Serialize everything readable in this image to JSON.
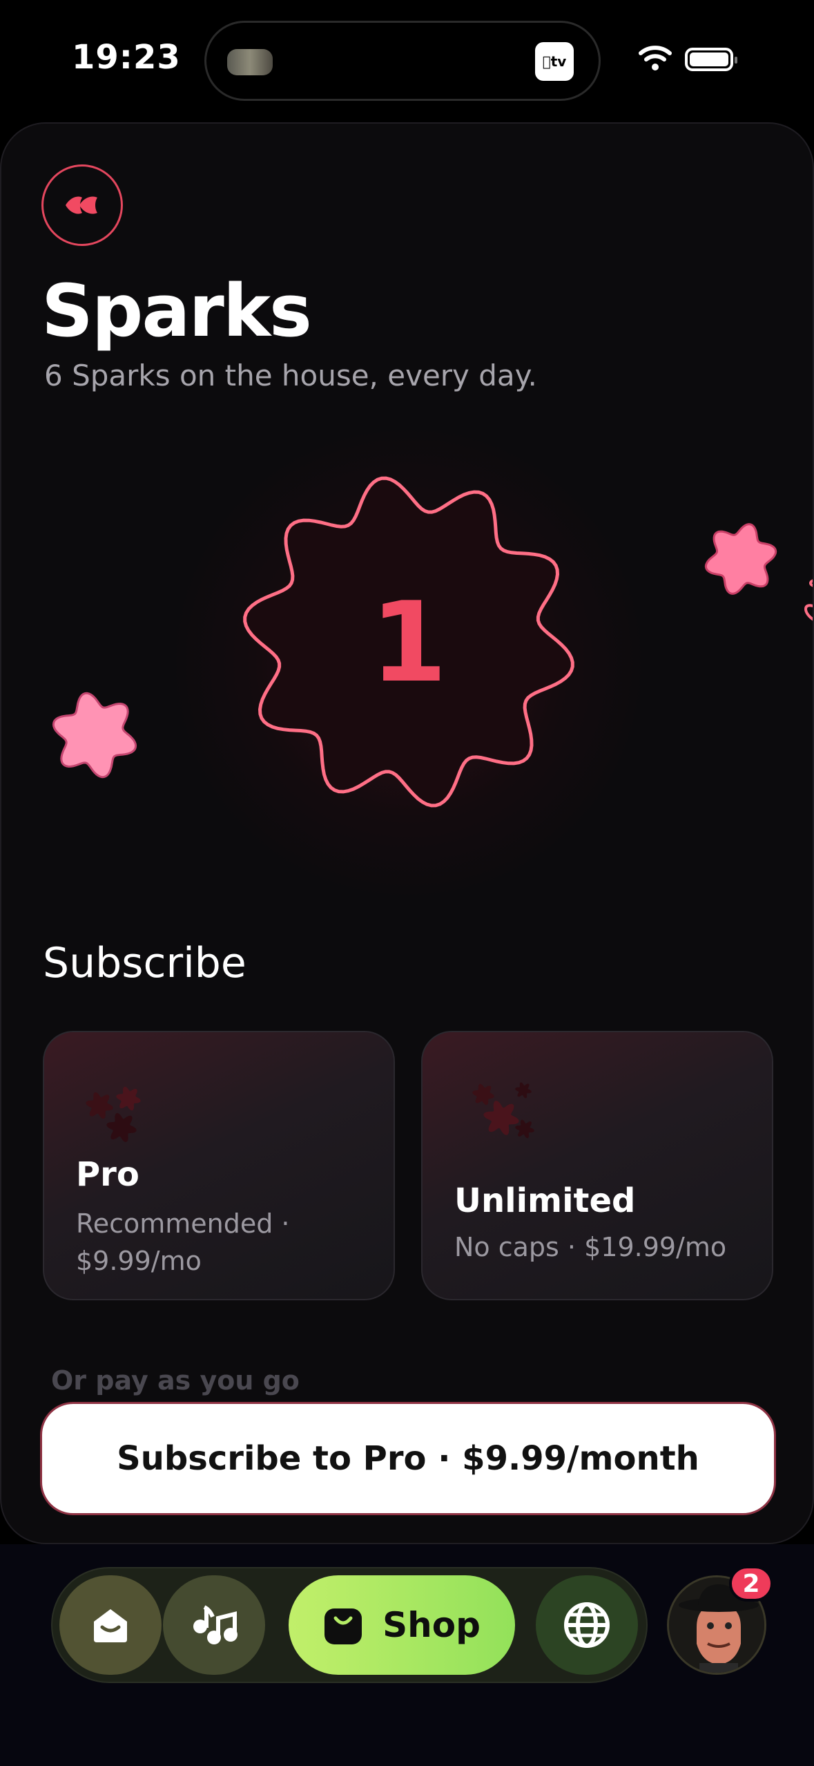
{
  "status_bar": {
    "time": "19:23",
    "island_app_label": "tv"
  },
  "header": {
    "title": "Sparks",
    "subtitle": "6 Sparks on the house, every day."
  },
  "spark_counter": {
    "value": "1"
  },
  "subscribe": {
    "section_title": "Subscribe",
    "plans": [
      {
        "name": "Pro",
        "description_line1": "Recommended ·",
        "description_line2": "$9.99/mo"
      },
      {
        "name": "Unlimited",
        "description": "No caps · $19.99/mo"
      }
    ]
  },
  "pay_as_you_go_label": "Or pay as you go",
  "cta": {
    "label": "Subscribe to Pro · $9.99/month"
  },
  "tabbar": {
    "items": [
      {
        "icon": "home-icon"
      },
      {
        "icon": "music-icon"
      },
      {
        "icon": "shopping-bag-icon",
        "label": "Shop",
        "active": true
      },
      {
        "icon": "globe-icon"
      }
    ],
    "avatar_badge": "2"
  },
  "colors": {
    "accent": "#f14a62",
    "shop_green": "#a8e85f",
    "background": "#0c0b0d"
  }
}
